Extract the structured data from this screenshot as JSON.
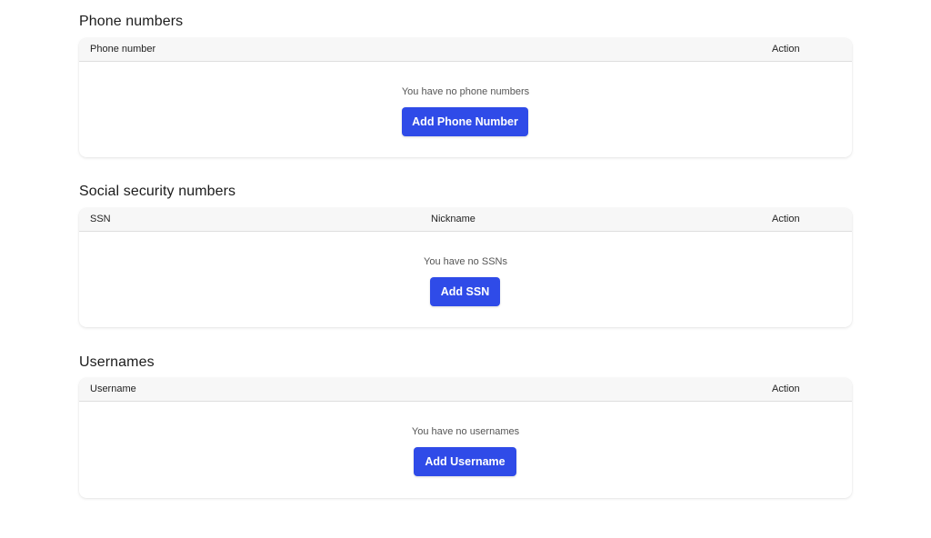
{
  "phone_numbers": {
    "title": "Phone numbers",
    "columns": [
      "Phone number",
      "Action"
    ],
    "empty_text": "You have no phone numbers",
    "button_label": "Add Phone Number"
  },
  "ssn": {
    "title": "Social security numbers",
    "columns": [
      "SSN",
      "Nickname",
      "Action"
    ],
    "empty_text": "You have no SSNs",
    "button_label": "Add SSN"
  },
  "usernames": {
    "title": "Usernames",
    "columns": [
      "Username",
      "Action"
    ],
    "empty_text": "You have no usernames",
    "button_label": "Add Username"
  },
  "colors": {
    "accent": "#2f4be8",
    "header_bg": "#f7f7f7"
  }
}
